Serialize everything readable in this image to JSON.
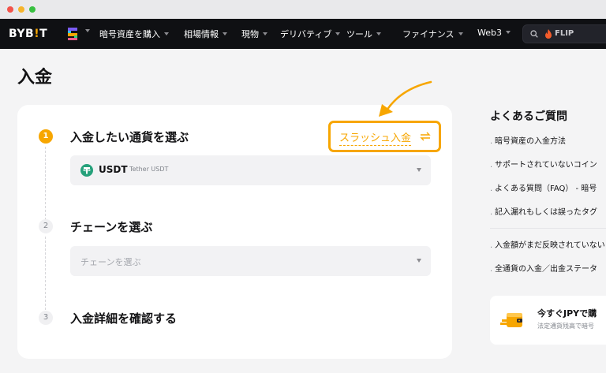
{
  "nav": {
    "logo": "BYB!T",
    "items": [
      {
        "label": "暗号資産を購入"
      },
      {
        "label": "相場情報"
      },
      {
        "label": "現物"
      },
      {
        "label": "デリバティブ"
      },
      {
        "label": "ツール"
      },
      {
        "label": "ファイナンス"
      },
      {
        "label": "Web3"
      }
    ],
    "search_text": "FLIP"
  },
  "page": {
    "title": "入金"
  },
  "steps": [
    {
      "num": "1",
      "title": "入金したい通貨を選ぶ"
    },
    {
      "num": "2",
      "title": "チェーンを選ぶ"
    },
    {
      "num": "3",
      "title": "入金詳細を確認する"
    }
  ],
  "coin_select": {
    "symbol": "USDT",
    "name": "Tether USDT"
  },
  "chain_select": {
    "placeholder": "チェーンを選ぶ"
  },
  "slash": {
    "label": "スラッシュ入金"
  },
  "faq": {
    "title": "よくあるご質問",
    "group1": [
      "暗号資産の入金方法",
      "サポートされていないコイン",
      "よくある質問（FAQ） - 暗号",
      "記入漏れもしくは誤ったタグ"
    ],
    "group2": [
      "入金額がまだ反映されていない",
      "全通貨の入金／出金ステータ"
    ],
    "promo_title": "今すぐJPYで購",
    "promo_sub": "法定通貨残高で暗号"
  },
  "colors": {
    "accent": "#f7a600",
    "tether": "#26a17b",
    "navbar": "#0f1013"
  }
}
